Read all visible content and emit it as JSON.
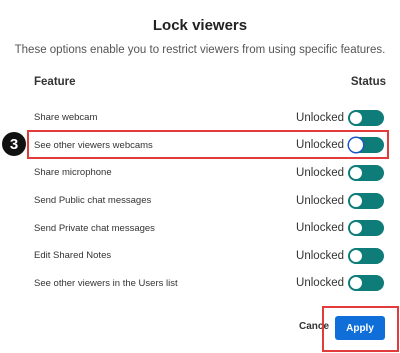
{
  "dialog": {
    "title": "Lock viewers",
    "subtitle": "These options enable you to restrict viewers from using specific features."
  },
  "columns": {
    "feature": "Feature",
    "status": "Status"
  },
  "features": [
    {
      "label": "Share webcam",
      "status": "Unlocked",
      "enabled": true
    },
    {
      "label": "See other viewers webcams",
      "status": "Unlocked",
      "enabled": true
    },
    {
      "label": "Share microphone",
      "status": "Unlocked",
      "enabled": true
    },
    {
      "label": "Send Public chat messages",
      "status": "Unlocked",
      "enabled": true
    },
    {
      "label": "Send Private chat messages",
      "status": "Unlocked",
      "enabled": true
    },
    {
      "label": "Edit Shared Notes",
      "status": "Unlocked",
      "enabled": true
    },
    {
      "label": "See other viewers in the Users list",
      "status": "Unlocked",
      "enabled": true
    }
  ],
  "annotation": {
    "step_number": "3"
  },
  "footer": {
    "cancel_label": "Cance",
    "apply_label": "Apply"
  },
  "colors": {
    "toggle_on": "#0e7c78",
    "apply_button": "#0f6ed8",
    "highlight": "#e23b3b"
  }
}
